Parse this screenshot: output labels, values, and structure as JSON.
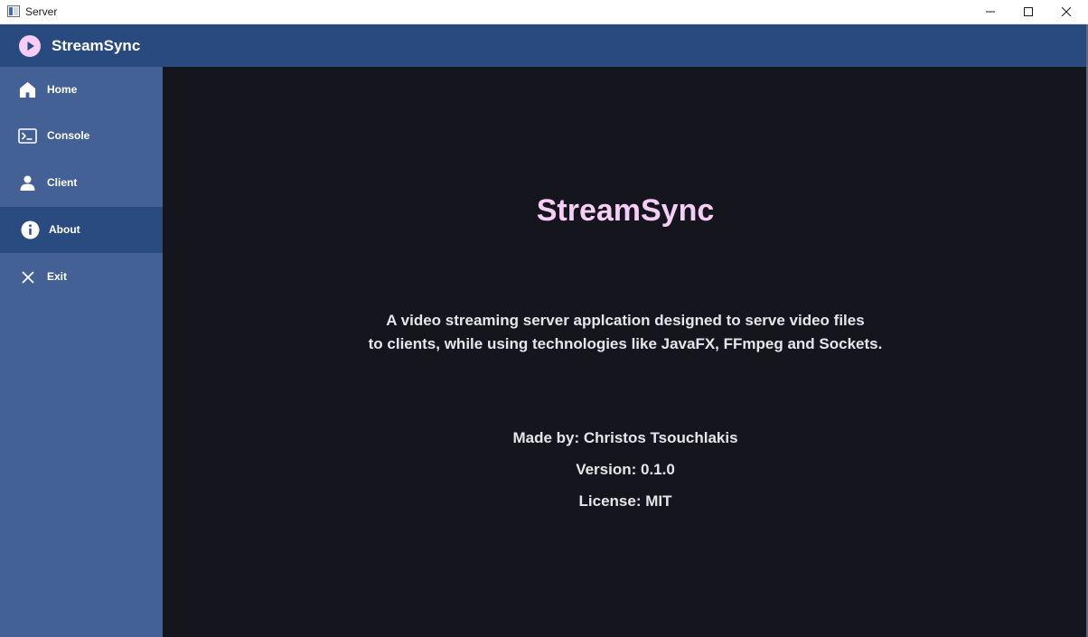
{
  "window": {
    "title": "Server"
  },
  "header": {
    "app_name": "StreamSync",
    "logo_icon": "play-circle-icon",
    "logo_color": "#f5cdf5"
  },
  "sidebar": {
    "items": [
      {
        "label": "Home",
        "icon": "home-icon",
        "active": false
      },
      {
        "label": "Console",
        "icon": "console-icon",
        "active": false
      },
      {
        "label": "Client",
        "icon": "user-icon",
        "active": false
      },
      {
        "label": "About",
        "icon": "info-icon",
        "active": true
      },
      {
        "label": "Exit",
        "icon": "close-icon",
        "active": false
      }
    ]
  },
  "about": {
    "title": "StreamSync",
    "description_line1": "A video streaming server applcation designed to serve video files",
    "description_line2": "to clients, while using technologies like JavaFX, FFmpeg and Sockets.",
    "made_by": "Made by: Christos Tsouchlakis",
    "version": "Version: 0.1.0",
    "license": "License: MIT"
  },
  "colors": {
    "header_bg": "#284a7e",
    "sidebar_bg": "#446195",
    "sidebar_active_bg": "#2a4b7f",
    "main_bg": "#15161d",
    "title_color": "#f5cdf5",
    "text_color": "#e6e6ea"
  }
}
